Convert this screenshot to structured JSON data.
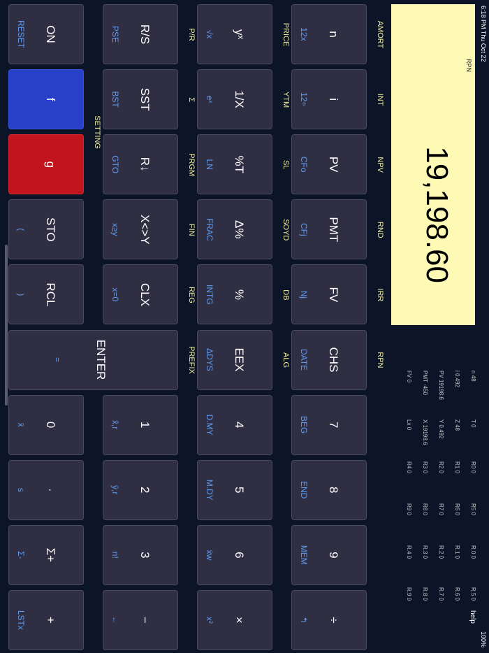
{
  "status": {
    "time": "6:18 PM  Thu Oct 22",
    "right": "100%"
  },
  "display": {
    "mode": "RPN",
    "value": "19,198.60"
  },
  "registers": {
    "c1": [
      "n 48",
      "i 0.492",
      "PV 19198.6",
      "PMT -450",
      "FV 0"
    ],
    "c2": [
      "T 0",
      "Z 48",
      "Y 0.492",
      "X 19198.6",
      "Lx 0"
    ],
    "c3": [
      "R0 0",
      "R1 0",
      "R2 0",
      "R3 0",
      "R4 0"
    ],
    "c4": [
      "R5 0",
      "R6 0",
      "R7 0",
      "R8 0",
      "R9 0"
    ],
    "c5": [
      "R.0 0",
      "R.1 0",
      "R.2 0",
      "R.3 0",
      "R.4 0"
    ],
    "c6": [
      "R.5 0",
      "R.6 0",
      "R.7 0",
      "R.8 0",
      "R.9 0"
    ]
  },
  "help": "help",
  "labels": {
    "row1": [
      "AMORT",
      "INT",
      "NPV",
      "RND",
      "IRR",
      "RPN"
    ],
    "row2": [
      "PRICE",
      "YTM",
      "SL",
      "SOYD",
      "DB",
      "ALG"
    ],
    "row3": [
      "P/R",
      "Σ",
      "PRGM",
      "FIN",
      "REG",
      "PREFIX"
    ],
    "row4": [
      "SETTING"
    ]
  },
  "keys": {
    "r1": [
      {
        "main": "n",
        "sub": "12x"
      },
      {
        "main": "i",
        "sub": "12÷"
      },
      {
        "main": "PV",
        "sub": "CFo"
      },
      {
        "main": "PMT",
        "sub": "CFj"
      },
      {
        "main": "FV",
        "sub": "Nj"
      },
      {
        "main": "CHS",
        "sub": "DATE"
      },
      {
        "main": "7",
        "sub": "BEG"
      },
      {
        "main": "8",
        "sub": "END"
      },
      {
        "main": "9",
        "sub": "MEM"
      },
      {
        "main": "÷",
        "sub": "↰"
      }
    ],
    "r2": [
      {
        "main": "yˣ",
        "sub": "√x"
      },
      {
        "main": "1/X",
        "sub": "eˣ"
      },
      {
        "main": "%T",
        "sub": "LN"
      },
      {
        "main": "Δ%",
        "sub": "FRAC"
      },
      {
        "main": "%",
        "sub": "INTG"
      },
      {
        "main": "EEX",
        "sub": "ΔDYS"
      },
      {
        "main": "4",
        "sub": "D.MY"
      },
      {
        "main": "5",
        "sub": "M.DY"
      },
      {
        "main": "6",
        "sub": "x̄w"
      },
      {
        "main": "×",
        "sub": "x²"
      }
    ],
    "r3": [
      {
        "main": "R/S",
        "sub": "PSE"
      },
      {
        "main": "SST",
        "sub": "BST"
      },
      {
        "main": "R↓",
        "sub": "GTO"
      },
      {
        "main": "X<>Y",
        "sub": "x≥y"
      },
      {
        "main": "CLX",
        "sub": "x=0"
      },
      {
        "main": "1",
        "sub": "x̂,r"
      },
      {
        "main": "2",
        "sub": "ŷ,r"
      },
      {
        "main": "3",
        "sub": "n!"
      },
      {
        "main": "−",
        "sub": "←"
      }
    ],
    "r4": [
      {
        "main": "ON",
        "sub": "RESET"
      },
      {
        "main": "f",
        "sub": ""
      },
      {
        "main": "g",
        "sub": ""
      },
      {
        "main": "STO",
        "sub": "("
      },
      {
        "main": "RCL",
        "sub": ")"
      },
      {
        "main": "0",
        "sub": "x̄"
      },
      {
        "main": "·",
        "sub": "s"
      },
      {
        "main": "Σ+",
        "sub": "Σ-"
      },
      {
        "main": "+",
        "sub": "LSTx"
      }
    ],
    "enter": {
      "main": "ENTER",
      "sub": "="
    }
  }
}
